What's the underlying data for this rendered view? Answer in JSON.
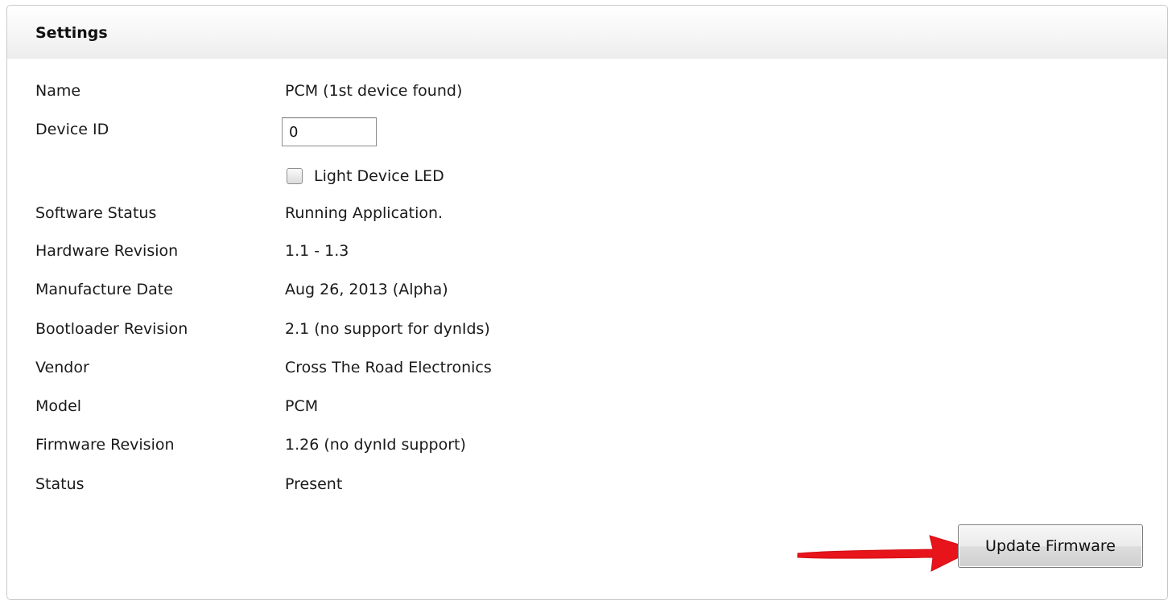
{
  "settings": {
    "title": "Settings",
    "name_label": "Name",
    "name_value": "PCM (1st device found)",
    "device_id_label": "Device ID",
    "device_id_value": "0",
    "light_led_label": "Light Device LED",
    "light_led_checked": false,
    "software_status_label": "Software Status",
    "software_status_value": "Running Application.",
    "hardware_revision_label": "Hardware Revision",
    "hardware_revision_value": "1.1 - 1.3",
    "manufacture_date_label": "Manufacture Date",
    "manufacture_date_value": "Aug 26, 2013 (Alpha)",
    "bootloader_revision_label": "Bootloader Revision",
    "bootloader_revision_value": "2.1 (no support for dynIds)",
    "vendor_label": "Vendor",
    "vendor_value": "Cross The Road Electronics",
    "model_label": "Model",
    "model_value": "PCM",
    "firmware_revision_label": "Firmware Revision",
    "firmware_revision_value": "1.26 (no dynId support)",
    "status_label": "Status",
    "status_value": "Present",
    "update_button_label": "Update Firmware"
  },
  "annotation": {
    "arrow_icon": "right-arrow-icon",
    "arrow_color": "#e8141b"
  }
}
